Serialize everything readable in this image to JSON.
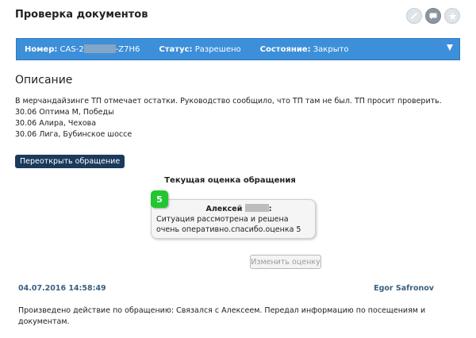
{
  "header": {
    "title": "Проверка документов"
  },
  "top_icons": [
    "link-icon",
    "chat-icon",
    "star-icon"
  ],
  "info_bar": {
    "number_label": "Номер:",
    "number_prefix": "CAS-2",
    "number_suffix": "-Z7H6",
    "status_label": "Статус:",
    "status_value": "Разрешено",
    "state_label": "Состояние:",
    "state_value": "Закрыто",
    "color": "#3d8fd9"
  },
  "description": {
    "title": "Описание",
    "lines": [
      "В мерчандайзинге ТП отмечает остатки. Руководство сообщило, что ТП там не был. ТП просит проверить.",
      "30.06 Оптима М, Победы",
      "30.06 Алира, Чехова",
      "30.06 Лига, Бубинское шоссе"
    ]
  },
  "reopen_button": "Переоткрыть обращение",
  "rating": {
    "heading": "Текущая оценка обращения",
    "score": "5",
    "rater_name": "Алексей",
    "rater_suffix": ":",
    "comment": "Ситуация рассмотрена и решена очень оперативно.спасибо.оценка 5",
    "change_button": "Изменить оценку"
  },
  "entry": {
    "date": "04.07.2016 14:58:49",
    "author": "Egor Safronov",
    "text": "Произведено действие по обращению: Связался с Алексеем. Передал информацию по посещениям и документам."
  }
}
